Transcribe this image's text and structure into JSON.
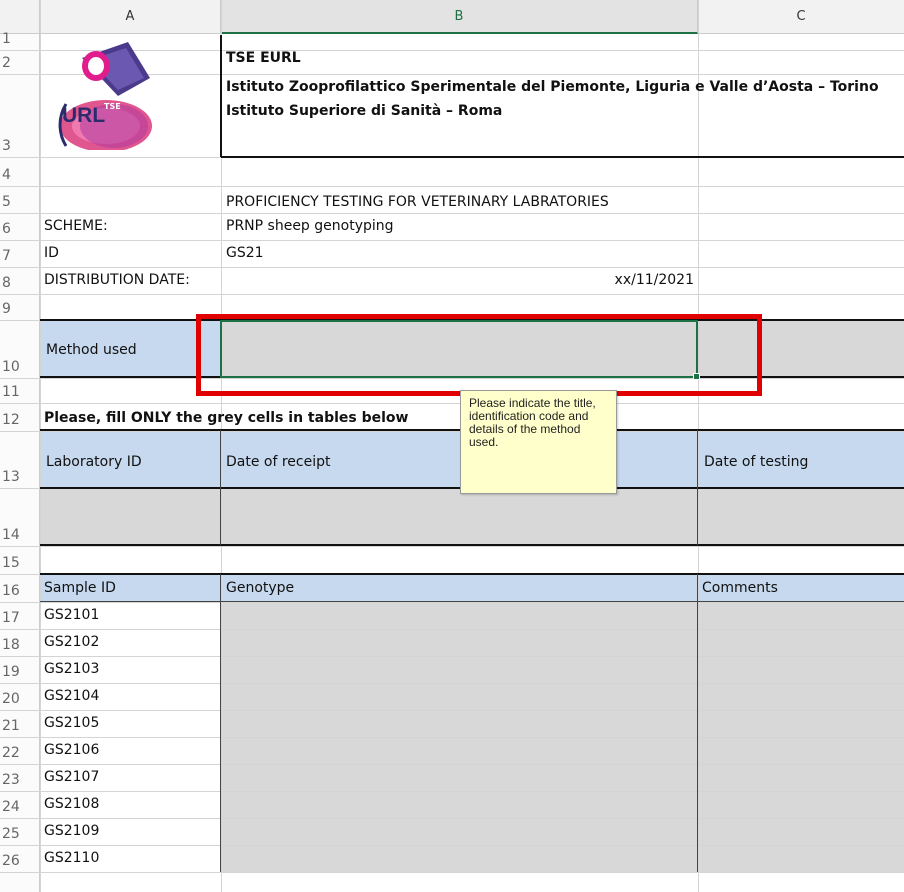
{
  "columns": [
    "A",
    "B",
    "C"
  ],
  "rows": [
    "1",
    "2",
    "3",
    "4",
    "5",
    "6",
    "7",
    "8",
    "9",
    "10",
    "11",
    "12",
    "13",
    "14",
    "15",
    "16",
    "17",
    "18",
    "19",
    "20",
    "21",
    "22",
    "23",
    "24",
    "25",
    "26"
  ],
  "logo": {
    "text": "URL",
    "superscript": "TSE"
  },
  "header": {
    "line1": "TSE EURL",
    "line2": "Istituto Zooprofilattico Sperimentale del Piemonte, Liguria e Valle d’Aosta – Torino",
    "line3": "Istituto Superiore di Sanità – Roma"
  },
  "info": {
    "title": "PROFICIENCY TESTING FOR VETERINARY LABRATORIES",
    "scheme_label": "SCHEME:",
    "scheme_value": "PRNP sheep genotyping",
    "id_label": "ID",
    "id_value": "GS21",
    "date_label": "DISTRIBUTION DATE:",
    "date_value": "xx/11/2021"
  },
  "method_label": "Method used",
  "instruction": "Please, fill ONLY the grey cells in tables below",
  "lab_table": {
    "headers": [
      "Laboratory ID",
      "Date of receipt",
      "Date of testing"
    ]
  },
  "sample_table": {
    "headers": [
      "Sample ID",
      "Genotype",
      "Comments"
    ],
    "samples": [
      "GS2101",
      "GS2102",
      "GS2103",
      "GS2104",
      "GS2105",
      "GS2106",
      "GS2107",
      "GS2108",
      "GS2109",
      "GS2110"
    ]
  },
  "tooltip": "Please indicate the title, identification code and details of the method used.",
  "colors": {
    "grey_cell": "#d8d8d8",
    "blue_header": "#c6d9ee",
    "highlight": "#e00000",
    "tooltip_bg": "#ffffcc",
    "active_col": "#1e7145"
  }
}
